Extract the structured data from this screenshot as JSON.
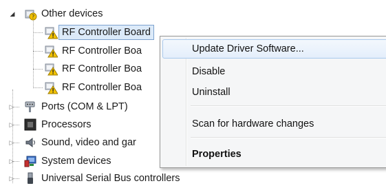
{
  "tree": {
    "other_devices": "Other devices",
    "children": [
      "RF Controller Board",
      "RF Controller Boa",
      "RF Controller Boa",
      "RF Controller Boa"
    ],
    "ports": "Ports (COM & LPT)",
    "processors": "Processors",
    "sound": "Sound, video and gar",
    "system_devices": "System devices",
    "usb": "Universal Serial Bus controllers"
  },
  "context_menu": {
    "update_driver": "Update Driver Software...",
    "disable": "Disable",
    "uninstall": "Uninstall",
    "scan": "Scan for hardware changes",
    "properties": "Properties"
  },
  "icons": {
    "other_devices": "unknown-device-category-icon",
    "rf_board": "device-warning-icon",
    "ports": "port-connector-icon",
    "processors": "processor-chip-icon",
    "sound": "speaker-icon",
    "system": "system-devices-icon",
    "usb": "usb-icon"
  },
  "colors": {
    "menu_highlight": "#dceaf9",
    "warning": "#f2c200"
  }
}
